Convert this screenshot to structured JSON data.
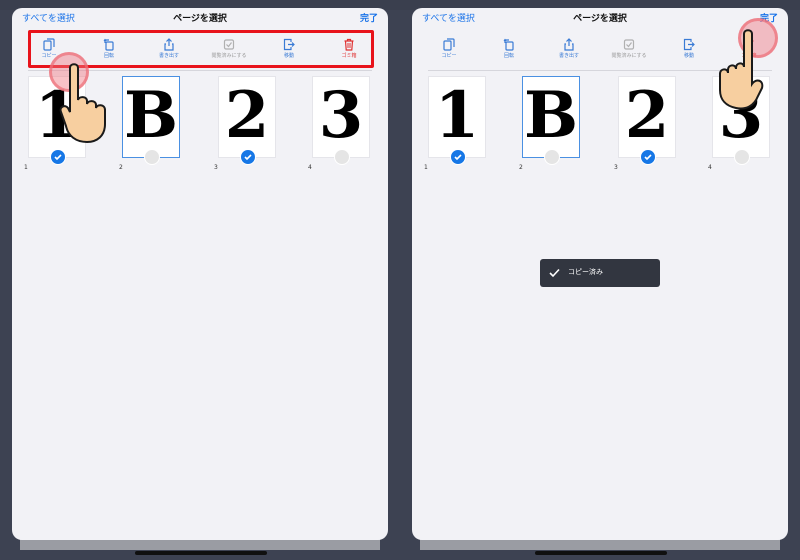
{
  "panels": [
    {
      "nav": {
        "select_all": "すべてを選択",
        "title": "ページを選択",
        "done": "完了"
      },
      "toolbar": [
        {
          "label": "コピー",
          "icon": "copy-icon",
          "state": "enabled"
        },
        {
          "label": "回転",
          "icon": "rotate-icon",
          "state": "enabled"
        },
        {
          "label": "書き出す",
          "icon": "share-icon",
          "state": "enabled"
        },
        {
          "label": "閲覧済みにする",
          "icon": "checkbox-icon",
          "state": "disabled"
        },
        {
          "label": "移動",
          "icon": "move-icon",
          "state": "enabled"
        },
        {
          "label": "ゴミ箱",
          "icon": "trash-icon",
          "state": "danger"
        }
      ],
      "pages": [
        {
          "glyph": "1",
          "number": "1",
          "selected": true
        },
        {
          "glyph": "B",
          "number": "2",
          "selected": false
        },
        {
          "glyph": "2",
          "number": "3",
          "selected": true
        },
        {
          "glyph": "3",
          "number": "4",
          "selected": false
        }
      ]
    },
    {
      "nav": {
        "select_all": "すべてを選択",
        "title": "ページを選択",
        "done": "完了"
      },
      "toolbar": [
        {
          "label": "コピー",
          "icon": "copy-icon",
          "state": "enabled"
        },
        {
          "label": "回転",
          "icon": "rotate-icon",
          "state": "enabled"
        },
        {
          "label": "書き出す",
          "icon": "share-icon",
          "state": "enabled"
        },
        {
          "label": "閲覧済みにする",
          "icon": "checkbox-icon",
          "state": "disabled"
        },
        {
          "label": "移動",
          "icon": "move-icon",
          "state": "enabled"
        },
        {
          "label": "ゴミ箱",
          "icon": "trash-icon",
          "state": "danger"
        }
      ],
      "pages": [
        {
          "glyph": "1",
          "number": "1",
          "selected": true
        },
        {
          "glyph": "B",
          "number": "2",
          "selected": false
        },
        {
          "glyph": "2",
          "number": "3",
          "selected": true
        },
        {
          "glyph": "3",
          "number": "4",
          "selected": false
        }
      ],
      "toast": "コピー済み"
    }
  ],
  "colors": {
    "accent": "#1a73e8",
    "danger": "#e03131",
    "highlight": "#e8131b",
    "check": "#1677e6",
    "toast_bg": "#323640"
  }
}
